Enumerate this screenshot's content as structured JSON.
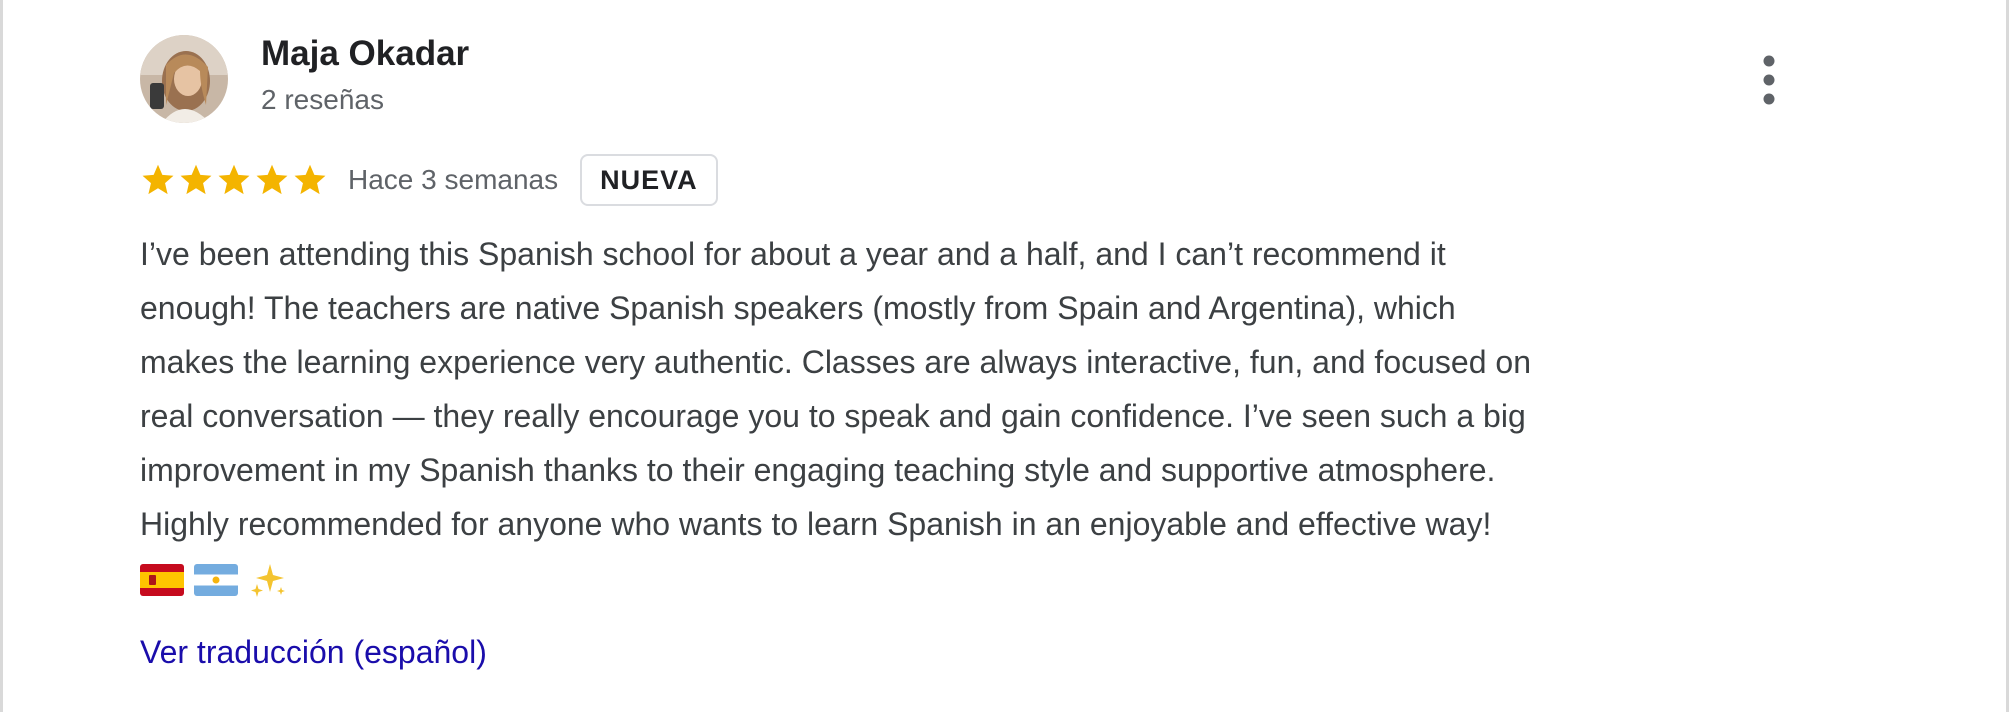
{
  "review": {
    "author_name": "Maja Okadar",
    "author_reviews": "2 reseñas",
    "rating": 5,
    "rating_max": 5,
    "time_ago": "Hace 3 semanas",
    "badge": "NUEVA",
    "text_lines": [
      "I’ve been attending this Spanish school for about a year and a half, and I can’t recommend it",
      "enough! The teachers are native Spanish speakers (mostly from Spain and Argentina), which",
      "makes the learning experience very authentic. Classes are always interactive, fun, and focused on",
      "real conversation — they really encourage you to speak and gain confidence. I’ve seen such a big",
      "improvement in my Spanish thanks to their engaging teaching style and supportive atmosphere.",
      "Highly recommended for anyone who wants to learn Spanish in an enjoyable and effective way!"
    ],
    "emojis": [
      "spain-flag-emoji",
      "argentina-flag-emoji",
      "sparkles-emoji"
    ],
    "translate_link": "Ver traducción (español)"
  },
  "icons": {
    "more": "more-vertical-icon",
    "star": "star-icon"
  },
  "colors": {
    "star": "#f4b400",
    "link": "#1a0dab",
    "name": "#202124",
    "secondary_text": "#5f6368",
    "body_text": "#3c4043",
    "badge_border": "#dadce0",
    "frame_border": "#d9d9d9"
  }
}
